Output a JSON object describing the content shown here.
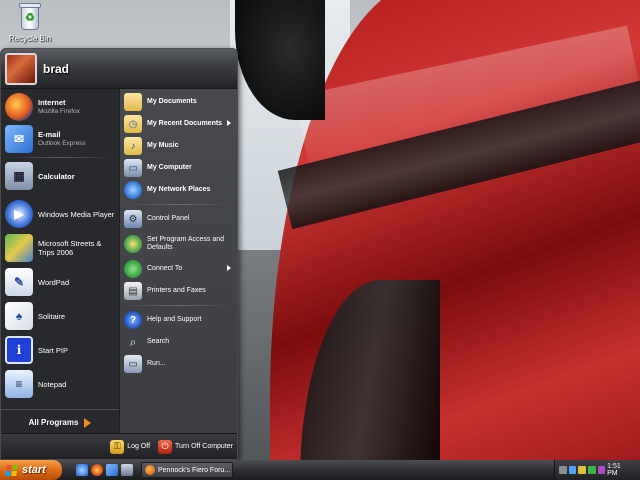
{
  "desktop": {
    "recycle_bin_label": "Recycle Bin"
  },
  "start_menu": {
    "user_name": "brad",
    "pinned": [
      {
        "title": "Internet",
        "subtitle": "Mozilla Firefox",
        "icon": "firefox-icon"
      },
      {
        "title": "E-mail",
        "subtitle": "Outlook Express",
        "icon": "outlook-express-icon"
      }
    ],
    "recent": [
      {
        "title": "Calculator",
        "icon": "calculator-icon"
      },
      {
        "title": "Windows Media Player",
        "icon": "media-player-icon"
      },
      {
        "title": "Microsoft Streets & Trips 2006",
        "icon": "streets-trips-icon"
      },
      {
        "title": "WordPad",
        "icon": "wordpad-icon"
      },
      {
        "title": "Solitaire",
        "icon": "solitaire-icon"
      },
      {
        "title": "Start PIP",
        "icon": "pip-icon"
      },
      {
        "title": "Notepad",
        "icon": "notepad-icon"
      }
    ],
    "all_programs_label": "All Programs",
    "right_top": [
      {
        "label": "My Documents",
        "icon": "folder-documents-icon"
      },
      {
        "label": "My Recent Documents",
        "icon": "recent-documents-icon"
      },
      {
        "label": "My Music",
        "icon": "folder-music-icon"
      },
      {
        "label": "My Computer",
        "icon": "computer-icon"
      },
      {
        "label": "My Network Places",
        "icon": "network-places-icon"
      }
    ],
    "right_mid": [
      {
        "label": "Control Panel",
        "icon": "control-panel-icon"
      },
      {
        "label": "Set Program Access and Defaults",
        "icon": "program-access-icon"
      },
      {
        "label": "Connect To",
        "icon": "connect-to-icon"
      },
      {
        "label": "Printers and Faxes",
        "icon": "printer-icon"
      }
    ],
    "right_bottom": [
      {
        "label": "Help and Support",
        "icon": "help-icon"
      },
      {
        "label": "Search",
        "icon": "search-icon"
      },
      {
        "label": "Run...",
        "icon": "run-icon"
      }
    ],
    "log_off_label": "Log Off",
    "turn_off_label": "Turn Off Computer"
  },
  "taskbar": {
    "start_label": "start",
    "task_label": "Pennock's Fiero Foru...",
    "clock": "1:51 PM"
  },
  "colors": {
    "accent_orange": "#de6d17",
    "menu_dark": "#2c2e31"
  }
}
